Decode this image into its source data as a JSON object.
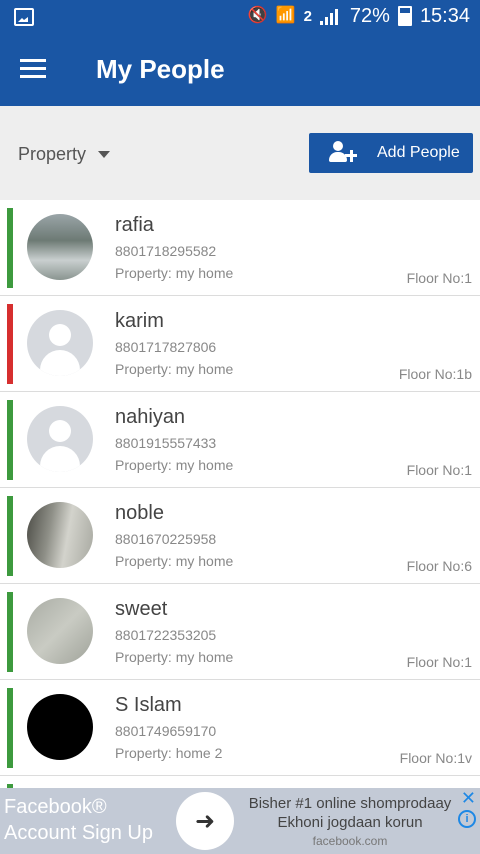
{
  "status_bar": {
    "battery_percent": "72%",
    "time": "15:34",
    "sim_number": "2"
  },
  "app_bar": {
    "title": "My People"
  },
  "filter": {
    "property_label": "Property",
    "add_button_label": "Add People"
  },
  "people": [
    {
      "name": "rafia",
      "phone": "8801718295582",
      "property": "Property: my home",
      "floor": "Floor No:1",
      "status_color": "#3d9a3e",
      "avatar": "photo-outdoor"
    },
    {
      "name": "karim",
      "phone": "8801717827806",
      "property": "Property: my home",
      "floor": "Floor No:1b",
      "status_color": "#d62f2f",
      "avatar": "default-avatar"
    },
    {
      "name": "nahiyan",
      "phone": "8801915557433",
      "property": "Property: my home",
      "floor": "Floor No:1",
      "status_color": "#3d9a3e",
      "avatar": "default-avatar"
    },
    {
      "name": "noble",
      "phone": "8801670225958",
      "property": "Property: my home",
      "floor": "Floor No:6",
      "status_color": "#3d9a3e",
      "avatar": "photo-room"
    },
    {
      "name": "sweet",
      "phone": "8801722353205",
      "property": "Property: my home",
      "floor": "Floor No:1",
      "status_color": "#3d9a3e",
      "avatar": "photo-grey"
    },
    {
      "name": "S Islam",
      "phone": "8801749659170",
      "property": "Property: home 2",
      "floor": "Floor No:1v",
      "status_color": "#3d9a3e",
      "avatar": "photo-black"
    }
  ],
  "ad": {
    "left_line1": "Facebook®",
    "left_line2": "Account Sign Up",
    "right_line1": "Bisher #1 online shomprodaay",
    "right_line2": "Ekhoni jogdaan korun",
    "url": "facebook.com"
  }
}
